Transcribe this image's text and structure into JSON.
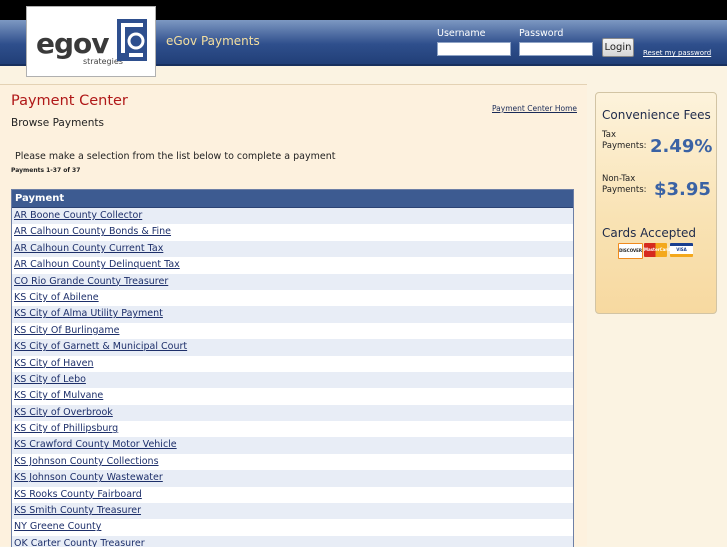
{
  "logo": {
    "word": "egov",
    "sub": "strategies"
  },
  "header": {
    "site_title": "eGov Payments",
    "username_label": "Username",
    "password_label": "Password",
    "login_button": "Login",
    "reset_link": "Reset my password"
  },
  "main": {
    "title": "Payment Center",
    "home_link": "Payment Center Home",
    "subtitle": "Browse Payments",
    "instructions": "Please make a selection from the list below to complete a payment",
    "count": "Payments 1-37 of 37",
    "table_header": "Payment",
    "payments": [
      "AR Boone County Collector",
      "AR Calhoun County Bonds & Fine",
      "AR Calhoun County Current Tax",
      "AR Calhoun County Delinquent Tax",
      "CO Rio Grande County Treasurer",
      "KS City of Abilene",
      "KS City of Alma Utility Payment",
      "KS City Of Burlingame",
      "KS City of Garnett & Municipal Court",
      "KS City of Haven",
      "KS City of Lebo",
      "KS City of Mulvane",
      "KS City of Overbrook",
      "KS City of Phillipsburg",
      "KS Crawford County Motor Vehicle",
      "KS Johnson County Collections",
      "KS Johnson County Wastewater",
      "KS Rooks County Fairboard",
      "KS Smith County Treasurer",
      "NY Greene County",
      "OK Carter County Treasurer"
    ]
  },
  "fees": {
    "title": "Convenience Fees",
    "tax_label_1": "Tax",
    "tax_label_2": "Payments:",
    "tax_value": "2.49%",
    "nontax_label_1": "Non-Tax",
    "nontax_label_2": "Payments:",
    "nontax_value": "$3.95",
    "cards_title": "Cards Accepted",
    "cards": [
      {
        "name": "DISCOVER",
        "icon": "discover-card-icon",
        "color": "#f08a1d"
      },
      {
        "name": "MasterCard",
        "icon": "mastercard-icon",
        "color": "#d62a1e"
      },
      {
        "name": "VISA",
        "icon": "visa-card-icon",
        "color": "#1a3f8f"
      }
    ]
  }
}
